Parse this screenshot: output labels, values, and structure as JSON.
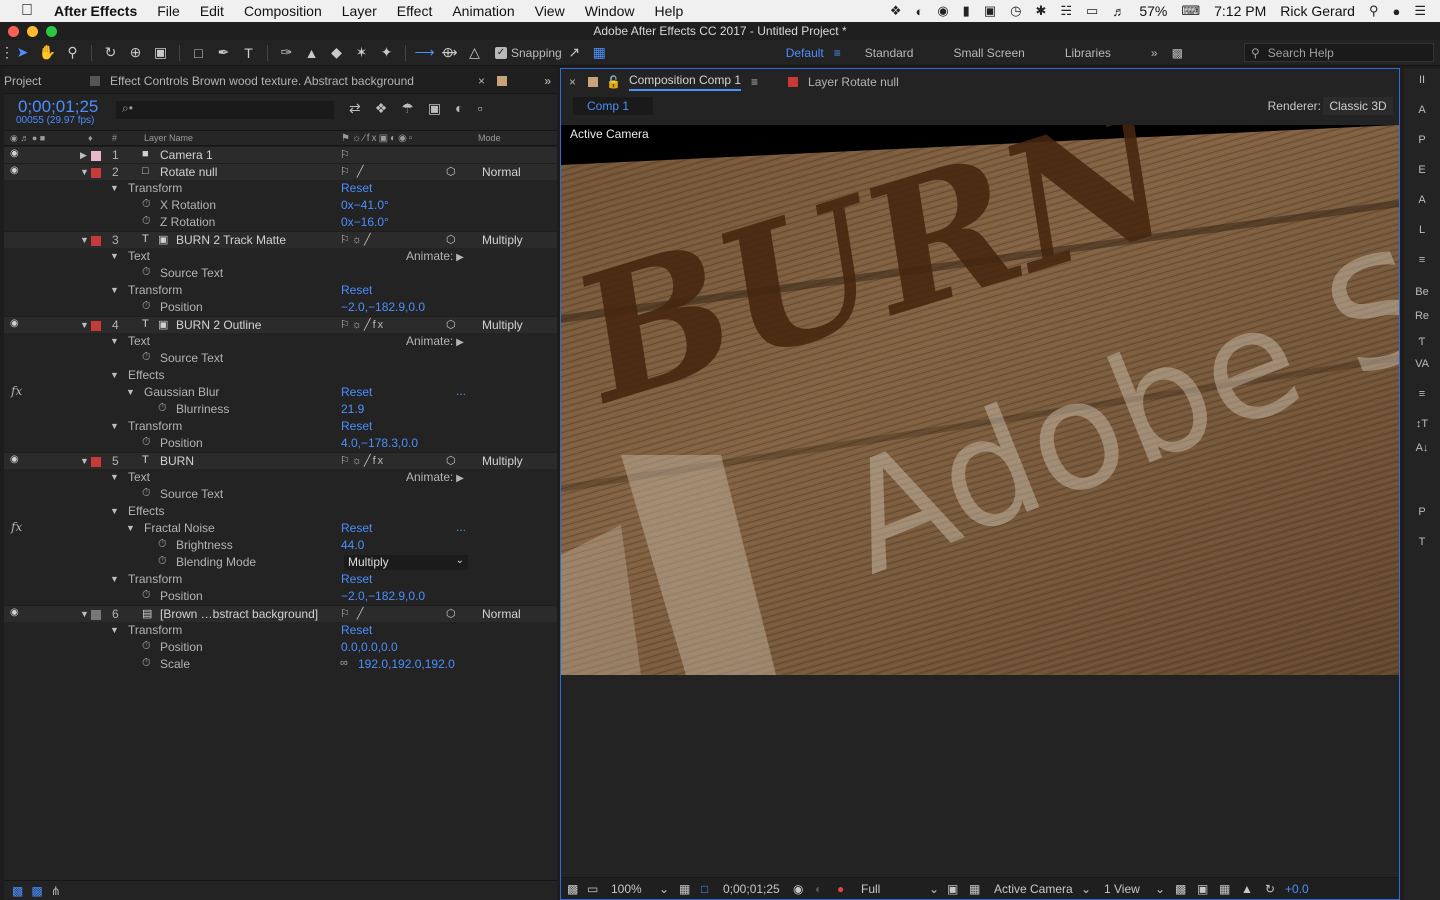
{
  "menubar": {
    "app": "After Effects",
    "items": [
      "File",
      "Edit",
      "Composition",
      "Layer",
      "Effect",
      "Animation",
      "View",
      "Window",
      "Help"
    ],
    "battery": "57%",
    "time": "7:12 PM",
    "user": "Rick Gerard"
  },
  "window": {
    "title": "Adobe After Effects CC 2017 - Untitled Project *"
  },
  "toolbar": {
    "snapping": "Snapping",
    "workspaces": [
      "Default",
      "Standard",
      "Small Screen",
      "Libraries"
    ],
    "active_workspace": "Default",
    "search_placeholder": "Search Help"
  },
  "left_panel": {
    "project_tab": "Project",
    "effect_controls_tab": "Effect Controls Brown wood texture. Abstract background",
    "timecode": "0;00;01;25",
    "fps": "00055 (29.97 fps)",
    "search_placeholder": "⌕•",
    "col_layer_name": "Layer Name",
    "col_mode": "Mode",
    "col_hash": "#"
  },
  "rows": [
    {
      "type": "layer",
      "num": "1",
      "label_color": "#e8b8c8",
      "icon": "■",
      "name": "Camera 1",
      "eye": true,
      "switches": "⚐",
      "mode": ""
    },
    {
      "type": "layer",
      "num": "2",
      "label_color": "#c83a3a",
      "icon": "□",
      "name": "Rotate null",
      "eye": true,
      "open": true,
      "switches": "⚐  ╱",
      "cube": true,
      "mode": "Normal"
    },
    {
      "type": "group",
      "indent": 1,
      "name": "Transform",
      "value": "Reset"
    },
    {
      "type": "prop",
      "indent": 2,
      "name": "X Rotation",
      "value": "0x−41.0°"
    },
    {
      "type": "prop",
      "indent": 2,
      "name": "Z Rotation",
      "value": "0x−16.0°"
    },
    {
      "type": "layer",
      "num": "3",
      "label_color": "#c83a3a",
      "icon": "T",
      "name": "BURN 2 Track Matte",
      "eye": false,
      "open": true,
      "switches": "⚐☼╱",
      "cube": true,
      "mode": "Multiply",
      "matte": true
    },
    {
      "type": "group",
      "indent": 1,
      "name": "Text",
      "animate": "Animate:"
    },
    {
      "type": "prop",
      "indent": 2,
      "name": "Source Text",
      "value": ""
    },
    {
      "type": "group",
      "indent": 1,
      "name": "Transform",
      "value": "Reset"
    },
    {
      "type": "prop",
      "indent": 2,
      "name": "Position",
      "value": "−2.0,−182.9,0.0"
    },
    {
      "type": "layer",
      "num": "4",
      "label_color": "#c83a3a",
      "icon": "T",
      "name": "BURN 2 Outline",
      "eye": true,
      "open": true,
      "switches": "⚐☼╱fx",
      "cube": true,
      "mode": "Multiply",
      "matte": true
    },
    {
      "type": "group",
      "indent": 1,
      "name": "Text",
      "animate": "Animate:"
    },
    {
      "type": "prop",
      "indent": 2,
      "name": "Source Text",
      "value": ""
    },
    {
      "type": "group",
      "indent": 1,
      "name": "Effects"
    },
    {
      "type": "group",
      "indent": 2,
      "name": "Gaussian Blur",
      "value": "Reset",
      "fx": true,
      "dots": "..."
    },
    {
      "type": "prop",
      "indent": 3,
      "name": "Blurriness",
      "value": "21.9"
    },
    {
      "type": "group",
      "indent": 1,
      "name": "Transform",
      "value": "Reset"
    },
    {
      "type": "prop",
      "indent": 2,
      "name": "Position",
      "value": "4.0,−178.3,0.0"
    },
    {
      "type": "layer",
      "num": "5",
      "label_color": "#c83a3a",
      "icon": "T",
      "name": "BURN",
      "eye": true,
      "open": true,
      "switches": "⚐☼╱fx",
      "cube": true,
      "mode": "Multiply"
    },
    {
      "type": "group",
      "indent": 1,
      "name": "Text",
      "animate": "Animate:"
    },
    {
      "type": "prop",
      "indent": 2,
      "name": "Source Text",
      "value": ""
    },
    {
      "type": "group",
      "indent": 1,
      "name": "Effects"
    },
    {
      "type": "group",
      "indent": 2,
      "name": "Fractal Noise",
      "value": "Reset",
      "fx": true,
      "dots": "..."
    },
    {
      "type": "prop",
      "indent": 3,
      "name": "Brightness",
      "value": "44.0"
    },
    {
      "type": "prop",
      "indent": 3,
      "name": "Blending Mode",
      "dropdown": "Multiply"
    },
    {
      "type": "group",
      "indent": 1,
      "name": "Transform",
      "value": "Reset"
    },
    {
      "type": "prop",
      "indent": 2,
      "name": "Position",
      "value": "−2.0,−182.9,0.0"
    },
    {
      "type": "layer",
      "num": "6",
      "label_color": "#777777",
      "icon": "▤",
      "name": "[Brown …bstract background]",
      "eye": true,
      "open": true,
      "switches": "⚐  ╱",
      "cube": true,
      "mode": "Normal"
    },
    {
      "type": "group",
      "indent": 1,
      "name": "Transform",
      "value": "Reset"
    },
    {
      "type": "prop",
      "indent": 2,
      "name": "Position",
      "value": "0.0,0.0,0.0"
    },
    {
      "type": "prop",
      "indent": 2,
      "name": "Scale",
      "value": "192.0,192.0,192.0",
      "link": true
    }
  ],
  "comp_panel": {
    "tab_comp": "Composition Comp 1",
    "tab_layer": "Layer Rotate null",
    "sub_tab": "Comp 1",
    "renderer_label": "Renderer:",
    "renderer_value": "Classic 3D",
    "active_camera": "Active Camera",
    "viewer_text_burn": "BURN",
    "viewer_text_adobe": "Adobe S"
  },
  "comp_footer": {
    "zoom": "100%",
    "timecode": "0;00;01;25",
    "resolution": "Full",
    "camera": "Active Camera",
    "views": "1 View",
    "exposure": "+0.0"
  },
  "right_rail": [
    "II",
    "A",
    "P",
    "E",
    "A",
    "L",
    "≡",
    "Be",
    "Re",
    "Ƭ",
    "VA",
    "≡",
    "↕T",
    "A↓",
    "P",
    "T"
  ],
  "colors": {
    "accent": "#4d8ffd",
    "label_red": "#c83a3a",
    "label_pink": "#e8b8c8",
    "label_gray": "#777777"
  }
}
